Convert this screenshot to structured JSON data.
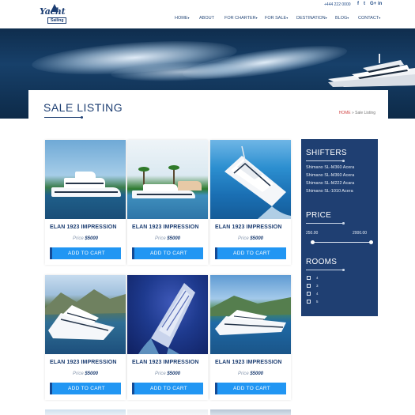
{
  "brand": {
    "name": "Yacht",
    "sub": "Sailing"
  },
  "topbar": {
    "phone": "+444 222 0000",
    "social": [
      "f",
      "t",
      "G+",
      "in"
    ]
  },
  "nav": [
    {
      "label": "HOME",
      "dropdown": true
    },
    {
      "label": "ABOUT",
      "dropdown": false
    },
    {
      "label": "FOR CHARTER",
      "dropdown": true
    },
    {
      "label": "FOR SALE",
      "dropdown": true
    },
    {
      "label": "DESTINATION",
      "dropdown": true
    },
    {
      "label": "BLOG",
      "dropdown": true
    },
    {
      "label": "CONTACT",
      "dropdown": true
    }
  ],
  "page": {
    "title": "SALE LISTING",
    "breadcrumb": {
      "home": "HOME",
      "separator": "»",
      "current": "Sale Listing"
    }
  },
  "listings": [
    {
      "name": "ELAN 1923 IMPRESSION",
      "price_label": "Price",
      "price": "$5000",
      "cart": "ADD TO CART"
    },
    {
      "name": "ELAN 1923 IMPRESSION",
      "price_label": "Price",
      "price": "$5000",
      "cart": "ADD TO CART"
    },
    {
      "name": "ELAN 1923 IMPRESSION",
      "price_label": "Price",
      "price": "$5000",
      "cart": "ADD TO CART"
    },
    {
      "name": "ELAN 1923 IMPRESSION",
      "price_label": "Price",
      "price": "$5000",
      "cart": "ADD TO CART"
    },
    {
      "name": "ELAN 1923 IMPRESSION",
      "price_label": "Price",
      "price": "$5000",
      "cart": "ADD TO CART"
    },
    {
      "name": "ELAN 1923 IMPRESSION",
      "price_label": "Price",
      "price": "$5000",
      "cart": "ADD TO CART"
    }
  ],
  "sidebar": {
    "shifters": {
      "title": "SHIFTERS",
      "items": [
        "Shimano SL-M360 Acera",
        "Shimano SL-M360 Acera",
        "Shimano SL-M222 Acara",
        "Shimano SL-1010 Acera"
      ]
    },
    "price": {
      "title": "PRICE",
      "min": "250.00",
      "max": "2000.00"
    },
    "rooms": {
      "title": "ROOMS",
      "options": [
        "4",
        "3",
        "4",
        "5"
      ]
    }
  },
  "colors": {
    "primary": "#1f3f72",
    "button": "#2196f3",
    "accent": "#d14a4a"
  }
}
